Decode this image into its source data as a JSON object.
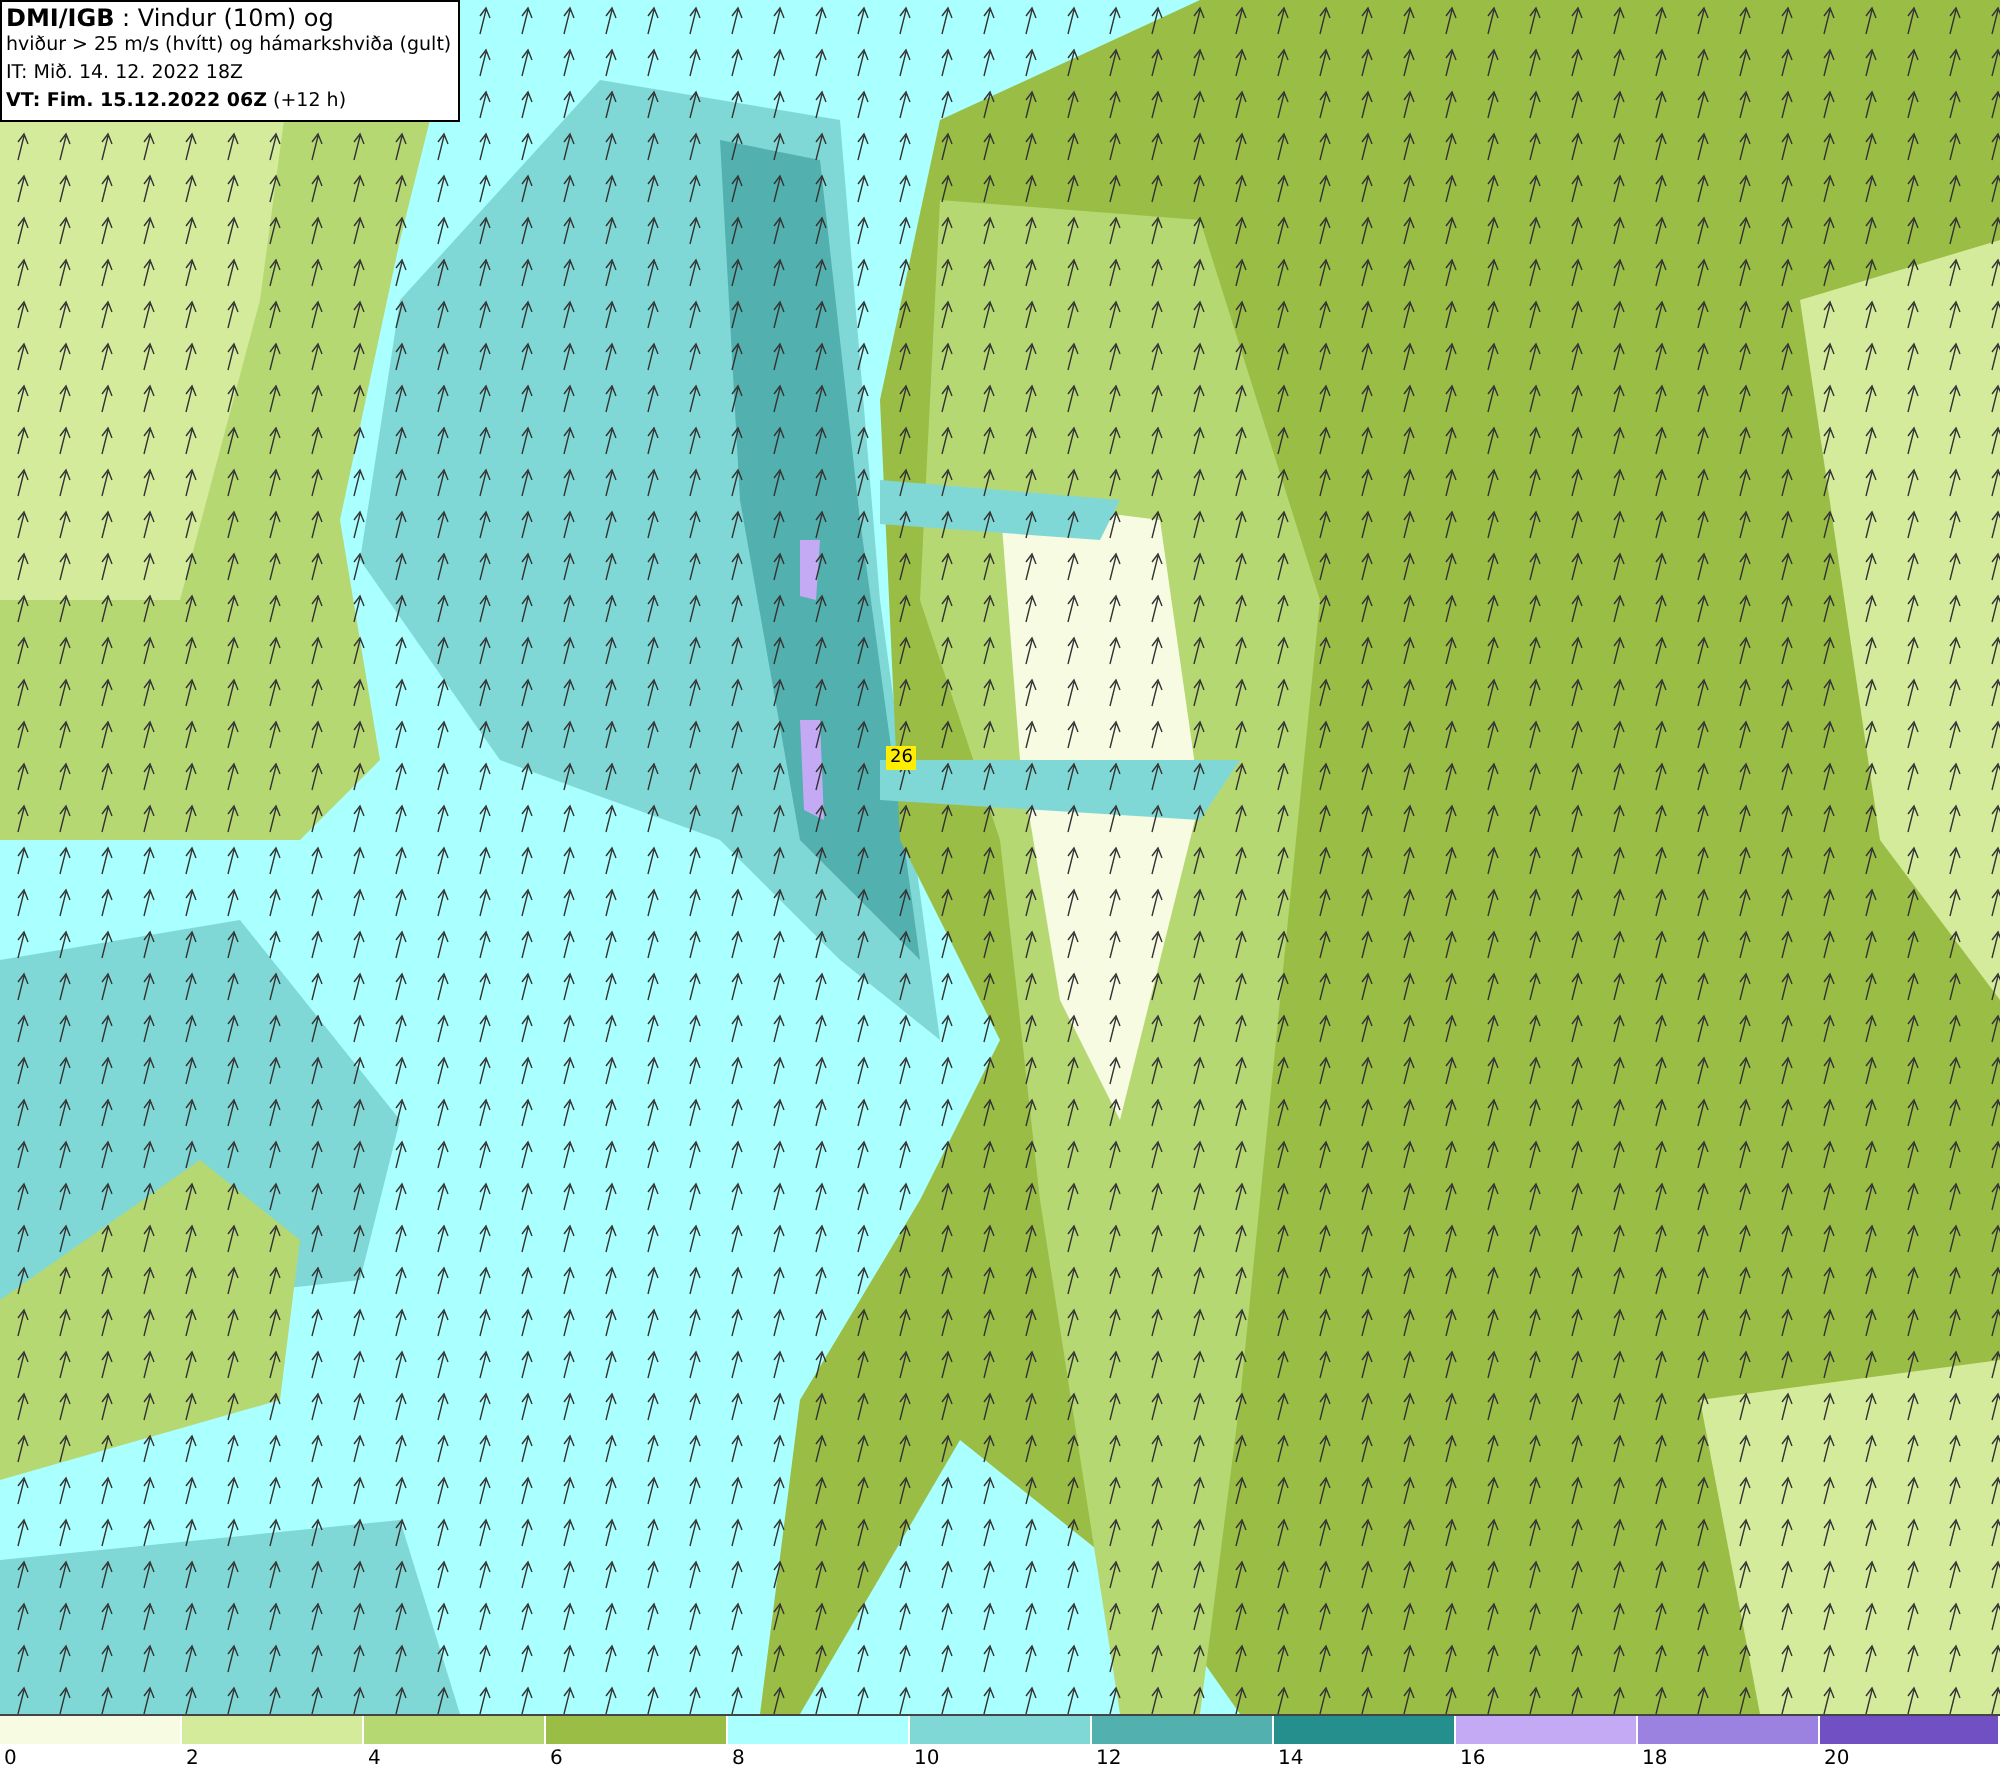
{
  "header": {
    "lines": [
      "**DMI/IGB** : Vindur (10m) og",
      "hviður > 25 m/s (hvítt) og hámarkshviða (gult)",
      "IT: Mið. 14. 12. 2022 18Z",
      "**VT: Fim. 15.12.2022 06Z** (+12 h)"
    ]
  },
  "map": {
    "gust_marker": "26"
  },
  "legend": {
    "bins": [
      {
        "color": "#f7fbe2"
      },
      {
        "color": "#d5eb9c"
      },
      {
        "color": "#b6d873"
      },
      {
        "color": "#9abd45"
      },
      {
        "color": "#aaffff"
      },
      {
        "color": "#80d8d6"
      },
      {
        "color": "#52b0ae"
      },
      {
        "color": "#248f8c"
      },
      {
        "color": "#c4aaf5"
      },
      {
        "color": "#9b82e0"
      },
      {
        "color": "#7050c2"
      }
    ],
    "ticks": [
      "0",
      "2",
      "4",
      "6",
      "8",
      "10",
      "12",
      "14",
      "16",
      "18",
      "20"
    ]
  }
}
